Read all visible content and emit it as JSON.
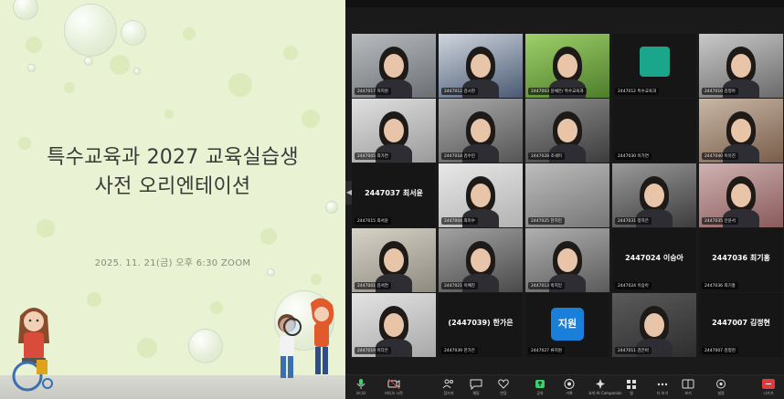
{
  "slide": {
    "title_line1": "특수교육과 2027 교육실습생",
    "title_line2": "사전 오리엔테이션",
    "subtitle": "2025. 11. 21(금) 오후 6:30 ZOOM"
  },
  "zoom": {
    "tiles": [
      {
        "id": "t1",
        "plate": "2447017 허지원",
        "kind": "person",
        "center": ""
      },
      {
        "id": "t2",
        "plate": "2447012 김시현",
        "kind": "person",
        "center": "",
        "active": true
      },
      {
        "id": "t3",
        "plate": "2447003 윤채은/ 특수교육과",
        "kind": "person",
        "center": ""
      },
      {
        "id": "t4",
        "plate": "2447012 특수교육과",
        "kind": "avatar-green",
        "center": ""
      },
      {
        "id": "t5",
        "plate": "2447010 김정아",
        "kind": "person",
        "center": ""
      },
      {
        "id": "t6",
        "plate": "2447005 최가연",
        "kind": "person",
        "center": ""
      },
      {
        "id": "t7",
        "plate": "2447018 김수민",
        "kind": "person",
        "center": ""
      },
      {
        "id": "t8",
        "plate": "2447028 조세미",
        "kind": "person",
        "center": ""
      },
      {
        "id": "t9",
        "plate": "2447030 이가연",
        "kind": "dark",
        "center": ""
      },
      {
        "id": "t10",
        "plate": "2447040 이유진",
        "kind": "person",
        "center": ""
      },
      {
        "id": "t11",
        "plate": "2447015 최서윤",
        "kind": "dark",
        "center": "2447037 최서윤"
      },
      {
        "id": "t12",
        "plate": "2447004 최미수",
        "kind": "person",
        "center": ""
      },
      {
        "id": "t13",
        "plate": "2447025 한지민",
        "kind": "room",
        "center": ""
      },
      {
        "id": "t14",
        "plate": "2447031 정하은",
        "kind": "person",
        "center": ""
      },
      {
        "id": "t15",
        "plate": "2447035 안윤서",
        "kind": "person",
        "center": ""
      },
      {
        "id": "t16",
        "plate": "2447001 김서연",
        "kind": "person",
        "center": ""
      },
      {
        "id": "t17",
        "plate": "2447021 이예진",
        "kind": "person",
        "center": ""
      },
      {
        "id": "t18",
        "plate": "2447013 박지민",
        "kind": "person",
        "center": ""
      },
      {
        "id": "t19",
        "plate": "2447024 이승아",
        "kind": "dark",
        "center": "2447024 이승아"
      },
      {
        "id": "t20",
        "plate": "2447036 최기홍",
        "kind": "dark",
        "center": "2447036 최기홍"
      },
      {
        "id": "t21",
        "plate": "2447019 이다은",
        "kind": "person",
        "center": ""
      },
      {
        "id": "t22",
        "plate": "2447039 한가은",
        "kind": "dark",
        "center": "(2447039) 한가은"
      },
      {
        "id": "t23",
        "plate": "2447027 류지원",
        "kind": "avatar-blue",
        "center": "지원"
      },
      {
        "id": "t24",
        "plate": "2447011 김은비",
        "kind": "person",
        "center": ""
      },
      {
        "id": "t25",
        "plate": "2447007 김정현",
        "kind": "dark",
        "center": "2447007 김정현"
      }
    ],
    "toolbar": [
      {
        "label": "오디오",
        "icon": "microphone-icon"
      },
      {
        "label": "비디오 시작",
        "icon": "video-camera-icon"
      },
      {
        "label": "참가자",
        "icon": "participants-icon"
      },
      {
        "label": "채팅",
        "icon": "chat-icon"
      },
      {
        "label": "반응",
        "icon": "reaction-icon"
      },
      {
        "label": "공유",
        "icon": "share-screen-icon"
      },
      {
        "label": "기록",
        "icon": "record-icon"
      },
      {
        "label": "요약 AI Companion",
        "icon": "ai-companion-icon"
      },
      {
        "label": "앱",
        "icon": "apps-icon"
      },
      {
        "label": "더 보기",
        "icon": "more-icon"
      },
      {
        "label": "보기",
        "icon": "view-icon"
      },
      {
        "label": "설정",
        "icon": "settings-icon"
      },
      {
        "label": "나가기",
        "icon": "leave-icon"
      }
    ]
  },
  "colors": {
    "slide_bg": "#e9f2d2",
    "zoom_bg": "#1a1a1a",
    "active_border": "#3bd16f",
    "avatar_green": "#1aa68a",
    "avatar_blue": "#1a7fd9",
    "leave_red": "#e0393e"
  }
}
